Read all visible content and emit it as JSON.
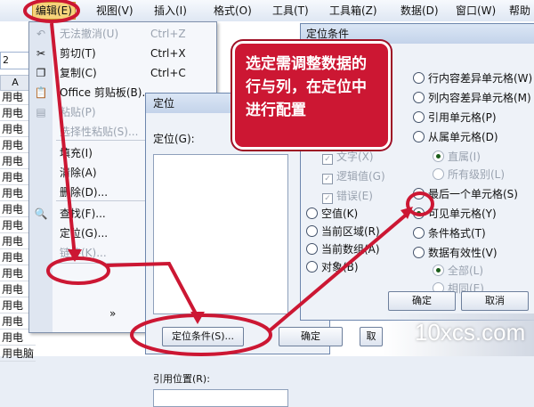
{
  "menubar": {
    "items": [
      "编辑(E)",
      "视图(V)",
      "插入(I)",
      "格式(O)",
      "工具(T)",
      "工具箱(Z)",
      "数据(D)",
      "窗口(W)",
      "帮助"
    ]
  },
  "sheet": {
    "name_box": "2",
    "col_header": "A",
    "rows": [
      "用电",
      "用电",
      "用电",
      "用电",
      "用电",
      "用电",
      "用电",
      "用电",
      "用电",
      "用电",
      "用电",
      "用电",
      "用电",
      "用电",
      "用电",
      "用电",
      "用电脑"
    ]
  },
  "edit_menu": {
    "items": [
      {
        "label": "无法撤消(U)",
        "shortcut": "Ctrl+Z",
        "icon": "undo-icon",
        "disabled": true
      },
      {
        "label": "剪切(T)",
        "shortcut": "Ctrl+X",
        "icon": "scissors-icon",
        "disabled": false
      },
      {
        "label": "复制(C)",
        "shortcut": "Ctrl+C",
        "icon": "copy-icon",
        "disabled": false
      },
      {
        "label": "Office 剪贴板(B)...",
        "shortcut": "",
        "icon": "clipboard-icon",
        "disabled": false
      },
      {
        "label": "粘贴(P)",
        "shortcut": "Ctrl+V",
        "icon": "paste-icon",
        "disabled": true
      },
      {
        "label": "选择性粘贴(S)...",
        "shortcut": "",
        "icon": "",
        "disabled": true
      },
      {
        "label": "填充(I)",
        "shortcut": "",
        "icon": "",
        "disabled": false
      },
      {
        "label": "清除(A)",
        "shortcut": "",
        "icon": "",
        "disabled": false
      },
      {
        "label": "删除(D)...",
        "shortcut": "",
        "icon": "",
        "disabled": false
      },
      {
        "label": "查找(F)...",
        "shortcut": "",
        "icon": "find-icon",
        "disabled": false
      },
      {
        "label": "定位(G)...",
        "shortcut": "",
        "icon": "",
        "disabled": false
      },
      {
        "label": "链接(K)...",
        "shortcut": "",
        "icon": "",
        "disabled": true
      },
      {
        "label": "»",
        "shortcut": "",
        "icon": "",
        "disabled": false
      }
    ]
  },
  "goto_dialog": {
    "title": "定位",
    "goto_label": "定位(G):",
    "ref_label": "引用位置(R):",
    "special_button": "定位条件(S)...",
    "ok_button": "确定",
    "cancel_button": "取"
  },
  "special_dialog": {
    "title": "定位条件",
    "right_options": [
      {
        "label": "行内容差异单元格(W)",
        "selected": false,
        "disabled": false
      },
      {
        "label": "列内容差异单元格(M)",
        "selected": false,
        "disabled": false
      },
      {
        "label": "引用单元格(P)",
        "selected": false,
        "disabled": false
      },
      {
        "label": "从属单元格(D)",
        "selected": false,
        "disabled": false
      },
      {
        "label": "直属(I)",
        "selected": true,
        "disabled": true
      },
      {
        "label": "所有级别(L)",
        "selected": false,
        "disabled": true
      },
      {
        "label": "最后一个单元格(S)",
        "selected": false,
        "disabled": false
      },
      {
        "label": "可见单元格(Y)",
        "selected": true,
        "disabled": false
      },
      {
        "label": "条件格式(T)",
        "selected": false,
        "disabled": false
      },
      {
        "label": "数据有效性(V)",
        "selected": false,
        "disabled": false
      },
      {
        "label": "全部(L)",
        "selected": true,
        "disabled": true
      },
      {
        "label": "相同(E)",
        "selected": false,
        "disabled": true
      }
    ],
    "left_checks": [
      "文字(X)",
      "逻辑值(G)",
      "错误(E)"
    ],
    "left_options": [
      "空值(K)",
      "当前区域(R)",
      "当前数组(A)",
      "对象(B)"
    ],
    "ok_button": "确定",
    "cancel_button": "取消"
  },
  "callout": {
    "text": "选定需调整数据的行与列，在定位中进行配置"
  },
  "watermark": "10xcs.com",
  "colors": {
    "annotation_red": "#cc1733",
    "menu_highlight": "#f6d37a",
    "title_bar": "#c3d3ea"
  }
}
